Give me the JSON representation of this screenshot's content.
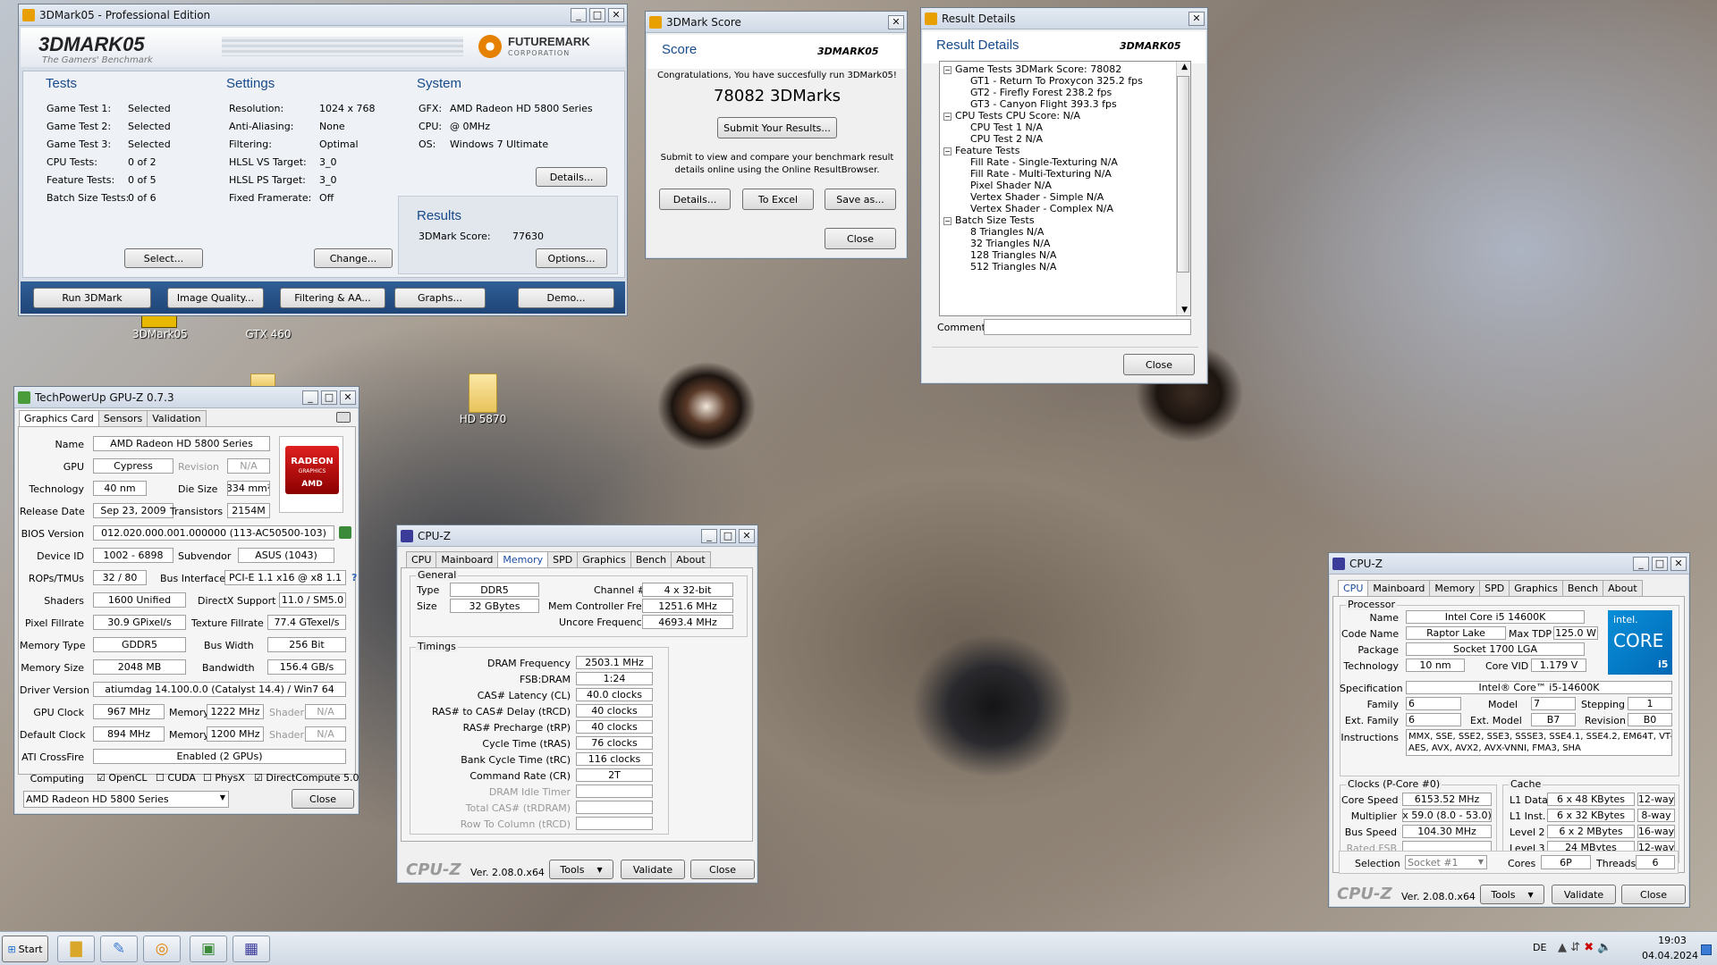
{
  "desktop": {
    "icons": [
      {
        "label": "3DMark05"
      },
      {
        "label": "GTX 460"
      },
      {
        "label": "HD 5870"
      }
    ]
  },
  "mark05": {
    "title": "3DMark05 - Professional Edition",
    "logo": "3DMARK05",
    "tagline": "The Gamers' Benchmark",
    "futuremark": "FUTUREMARK",
    "corporation": "CORPORATION",
    "tests": {
      "heading": "Tests",
      "rows": [
        {
          "label": "Game Test 1:",
          "value": "Selected"
        },
        {
          "label": "Game Test 2:",
          "value": "Selected"
        },
        {
          "label": "Game Test 3:",
          "value": "Selected"
        },
        {
          "label": "CPU Tests:",
          "value": "0 of 2"
        },
        {
          "label": "Feature Tests:",
          "value": "0 of 5"
        },
        {
          "label": "Batch Size Tests:",
          "value": "0 of 6"
        }
      ],
      "button": "Select..."
    },
    "settings": {
      "heading": "Settings",
      "rows": [
        {
          "label": "Resolution:",
          "value": "1024 x 768"
        },
        {
          "label": "Anti-Aliasing:",
          "value": "None"
        },
        {
          "label": "Filtering:",
          "value": "Optimal"
        },
        {
          "label": "HLSL VS Target:",
          "value": "3_0"
        },
        {
          "label": "HLSL PS Target:",
          "value": "3_0"
        },
        {
          "label": "Fixed Framerate:",
          "value": "Off"
        }
      ],
      "button": "Change..."
    },
    "system": {
      "heading": "System",
      "rows": [
        {
          "label": "GFX:",
          "value": "AMD Radeon HD 5800 Series"
        },
        {
          "label": "CPU:",
          "value": "@ 0MHz"
        },
        {
          "label": "OS:",
          "value": "Windows 7 Ultimate"
        }
      ],
      "button": "Details..."
    },
    "results": {
      "heading": "Results",
      "label": "3DMark Score:",
      "value": "77630",
      "button": "Options..."
    },
    "bottom": [
      "Run 3DMark",
      "Image Quality...",
      "Filtering & AA...",
      "Graphs...",
      "Demo..."
    ]
  },
  "score": {
    "title": "3DMark Score",
    "heading": "Score",
    "logo": "3DMARK05",
    "congrats": "Congratulations, You have succesfully run 3DMark05!",
    "value": "78082 3DMarks",
    "submit": "Submit Your Results...",
    "info1": "Submit to view and compare your benchmark result",
    "info2": "details online using the Online ResultBrowser.",
    "buttons": [
      "Details...",
      "To Excel",
      "Save as..."
    ],
    "close": "Close"
  },
  "results": {
    "title": "Result Details",
    "heading": "Result Details",
    "logo": "3DMARK05",
    "tree": [
      {
        "lvl": 0,
        "t": "Game Tests    3DMark Score: 78082"
      },
      {
        "lvl": 1,
        "t": "GT1 - Return To Proxycon   325.2 fps"
      },
      {
        "lvl": 1,
        "t": "GT2 - Firefly Forest   238.2 fps"
      },
      {
        "lvl": 1,
        "t": "GT3 - Canyon Flight   393.3 fps"
      },
      {
        "lvl": 0,
        "t": "CPU Tests    CPU Score: N/A"
      },
      {
        "lvl": 1,
        "t": "CPU Test 1   N/A"
      },
      {
        "lvl": 1,
        "t": "CPU Test 2   N/A"
      },
      {
        "lvl": 0,
        "t": "Feature Tests"
      },
      {
        "lvl": 1,
        "t": "Fill Rate - Single-Texturing   N/A"
      },
      {
        "lvl": 1,
        "t": "Fill Rate - Multi-Texturing   N/A"
      },
      {
        "lvl": 1,
        "t": "Pixel Shader   N/A"
      },
      {
        "lvl": 1,
        "t": "Vertex Shader - Simple   N/A"
      },
      {
        "lvl": 1,
        "t": "Vertex Shader - Complex   N/A"
      },
      {
        "lvl": 0,
        "t": "Batch Size Tests"
      },
      {
        "lvl": 1,
        "t": "8 Triangles   N/A"
      },
      {
        "lvl": 1,
        "t": "32 Triangles   N/A"
      },
      {
        "lvl": 1,
        "t": "128 Triangles   N/A"
      },
      {
        "lvl": 1,
        "t": "512 Triangles   N/A"
      }
    ],
    "comment": "Comment",
    "close": "Close"
  },
  "gpuz": {
    "title": "TechPowerUp GPU-Z 0.7.3",
    "tabs": [
      "Graphics Card",
      "Sensors",
      "Validation"
    ],
    "name_l": "Name",
    "name": "AMD Radeon HD 5800 Series",
    "gpu_l": "GPU",
    "gpu": "Cypress",
    "rev_l": "Revision",
    "rev": "N/A",
    "tech_l": "Technology",
    "tech": "40 nm",
    "die_l": "Die Size",
    "die": "334 mm²",
    "rel_l": "Release Date",
    "rel": "Sep 23, 2009",
    "trans_l": "Transistors",
    "trans": "2154M",
    "bios_l": "BIOS Version",
    "bios": "012.020.000.001.000000 (113-AC50500-103)",
    "dev_l": "Device ID",
    "dev": "1002 - 6898",
    "sub_l": "Subvendor",
    "sub": "ASUS (1043)",
    "rops_l": "ROPs/TMUs",
    "rops": "32 / 80",
    "bus_l": "Bus Interface",
    "bus": "PCI-E 1.1 x16 @ x8 1.1",
    "q": "?",
    "shad_l": "Shaders",
    "shad": "1600 Unified",
    "dx_l": "DirectX Support",
    "dx": "11.0 / SM5.0",
    "pfill_l": "Pixel Fillrate",
    "pfill": "30.9 GPixel/s",
    "tfill_l": "Texture Fillrate",
    "tfill": "77.4 GTexel/s",
    "mtype_l": "Memory Type",
    "mtype": "GDDR5",
    "bw_l": "Bus Width",
    "bw": "256 Bit",
    "msize_l": "Memory Size",
    "msize": "2048 MB",
    "band_l": "Bandwidth",
    "band": "156.4 GB/s",
    "drv_l": "Driver Version",
    "drv": "atiumdag 14.100.0.0 (Catalyst 14.4) / Win7 64",
    "gclk_l": "GPU Clock",
    "gclk": "967 MHz",
    "mem_l": "Memory",
    "gmem": "1222 MHz",
    "shader_l": "Shader",
    "gsh": "N/A",
    "dclk_l": "Default Clock",
    "dclk": "894 MHz",
    "dmem": "1200 MHz",
    "dsh": "N/A",
    "cf_l": "ATI CrossFire",
    "cf": "Enabled (2 GPUs)",
    "comp_l": "Computing",
    "opencl": "OpenCL",
    "cuda": "CUDA",
    "physx": "PhysX",
    "dc": "DirectCompute 5.0",
    "select": "AMD Radeon HD 5800 Series",
    "close": "Close",
    "logo1": "RADEON",
    "logo2": "GRAPHICS",
    "logo3": "AMD"
  },
  "cpuzmem": {
    "title": "CPU-Z",
    "tabs": [
      "CPU",
      "Mainboard",
      "Memory",
      "SPD",
      "Graphics",
      "Bench",
      "About"
    ],
    "general": "General",
    "type_l": "Type",
    "type": "DDR5",
    "ch_l": "Channel #",
    "ch": "4 x 32-bit",
    "size_l": "Size",
    "size": "32 GBytes",
    "mcf_l": "Mem Controller Freq.",
    "mcf": "1251.6 MHz",
    "unc_l": "Uncore Frequency",
    "unc": "4693.4 MHz",
    "timings": "Timings",
    "trows": [
      {
        "l": "DRAM Frequency",
        "v": "2503.1 MHz",
        "d": false
      },
      {
        "l": "FSB:DRAM",
        "v": "1:24",
        "d": false
      },
      {
        "l": "CAS# Latency (CL)",
        "v": "40.0 clocks",
        "d": false
      },
      {
        "l": "RAS# to CAS# Delay (tRCD)",
        "v": "40 clocks",
        "d": false
      },
      {
        "l": "RAS# Precharge (tRP)",
        "v": "40 clocks",
        "d": false
      },
      {
        "l": "Cycle Time (tRAS)",
        "v": "76 clocks",
        "d": false
      },
      {
        "l": "Bank Cycle Time (tRC)",
        "v": "116 clocks",
        "d": false
      },
      {
        "l": "Command Rate (CR)",
        "v": "2T",
        "d": false
      },
      {
        "l": "DRAM Idle Timer",
        "v": "",
        "d": true
      },
      {
        "l": "Total CAS# (tRDRAM)",
        "v": "",
        "d": true
      },
      {
        "l": "Row To Column (tRCD)",
        "v": "",
        "d": true
      }
    ],
    "brand": "CPU-Z",
    "ver": "Ver. 2.08.0.x64",
    "tools": "Tools",
    "validate": "Validate",
    "close": "Close"
  },
  "cpuzcpu": {
    "title": "CPU-Z",
    "tabs": [
      "CPU",
      "Mainboard",
      "Memory",
      "SPD",
      "Graphics",
      "Bench",
      "About"
    ],
    "processor": "Processor",
    "name_l": "Name",
    "name": "Intel Core i5 14600K",
    "code_l": "Code Name",
    "code": "Raptor Lake",
    "tdp_l": "Max TDP",
    "tdp": "125.0 W",
    "pkg_l": "Package",
    "pkg": "Socket 1700 LGA",
    "tech_l": "Technology",
    "tech": "10 nm",
    "vid_l": "Core VID",
    "vid": "1.179 V",
    "spec_l": "Specification",
    "spec": "Intel® Core™ i5-14600K",
    "fam_l": "Family",
    "fam": "6",
    "mod_l": "Model",
    "mod": "7",
    "step_l": "Stepping",
    "step": "1",
    "efam_l": "Ext. Family",
    "efam": "6",
    "emod_l": "Ext. Model",
    "emod": "B7",
    "rev_l": "Revision",
    "rev": "B0",
    "ins_l": "Instructions",
    "ins1": "MMX, SSE, SSE2, SSE3, SSSE3, SSE4.1, SSE4.2, EM64T, VT-x,",
    "ins2": "AES, AVX, AVX2, AVX-VNNI, FMA3, SHA",
    "clocks": "Clocks (P-Core #0)",
    "cs_l": "Core Speed",
    "cs": "6153.52 MHz",
    "mul_l": "Multiplier",
    "mul": "x 59.0 (8.0 - 53.0)",
    "bs_l": "Bus Speed",
    "bs": "104.30 MHz",
    "rf_l": "Rated FSB",
    "cache": "Cache",
    "l1d_l": "L1 Data",
    "l1d": "6 x 48 KBytes",
    "l1dw": "12-way",
    "l1i_l": "L1 Inst.",
    "l1i": "6 x 32 KBytes",
    "l1iw": "8-way",
    "l2_l": "Level 2",
    "l2": "6 x 2 MBytes",
    "l2w": "16-way",
    "l3_l": "Level 3",
    "l3": "24 MBytes",
    "l3w": "12-way",
    "sel_l": "Selection",
    "sel": "Socket #1",
    "cores_l": "Cores",
    "cores": "6P",
    "thr_l": "Threads",
    "thr": "6",
    "logo1": "intel.",
    "logo2": "CORE",
    "logo3": "i5",
    "brand": "CPU-Z",
    "ver": "Ver. 2.08.0.x64",
    "tools": "Tools",
    "validate": "Validate",
    "close": "Close"
  },
  "taskbar": {
    "start": "Start",
    "lang": "DE",
    "time": "19:03",
    "date": "04.04.2024"
  }
}
